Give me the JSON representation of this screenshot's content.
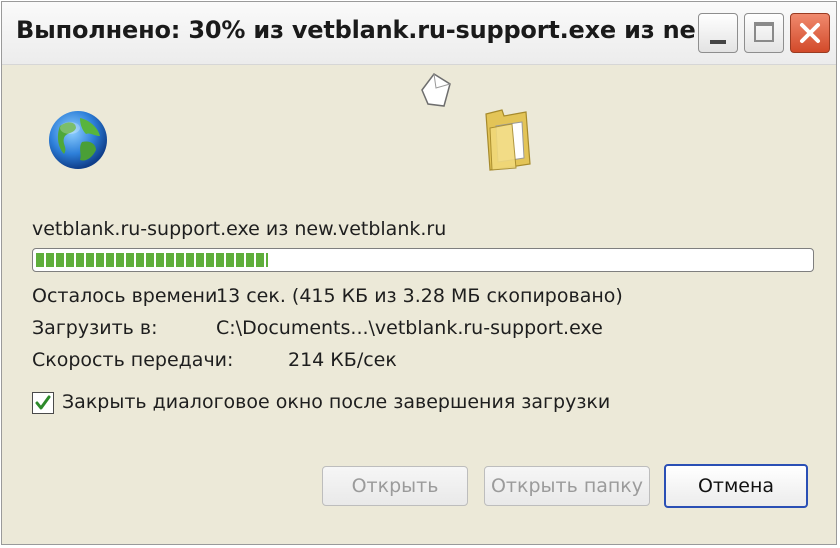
{
  "window": {
    "title": "Выполнено: 30% из vetblank.ru-support.exe из ne...",
    "controls": {
      "minimize": "minimize",
      "maximize": "maximize",
      "close": "close"
    }
  },
  "icons": {
    "globe": "globe-icon",
    "paper": "flying-document-icon",
    "folder": "folder-icon"
  },
  "download": {
    "file_line": "vetblank.ru-support.exe из new.vetblank.ru",
    "progress_percent": 30,
    "time_left_label": "Осталось времени",
    "time_left_value": "13 сек. (415 КБ из 3.28 МБ скопировано)",
    "save_to_label": "Загрузить в:",
    "save_to_value": "C:\\Documents...\\vetblank.ru-support.exe",
    "speed_label": "Скорость передачи:",
    "speed_value": "214 КБ/сек"
  },
  "checkbox": {
    "label": "Закрыть диалоговое окно после завершения загрузки",
    "checked": true
  },
  "buttons": {
    "open": "Открыть",
    "open_folder": "Открыть папку",
    "cancel": "Отмена"
  },
  "colors": {
    "progress": "#5fae3b",
    "accent": "#2a4fb5",
    "close_button": "#d24a2a"
  }
}
